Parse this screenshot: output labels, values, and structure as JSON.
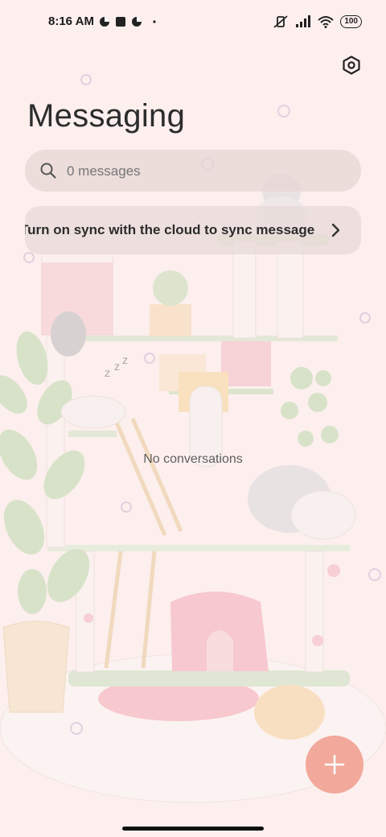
{
  "status_bar": {
    "time": "8:16 AM",
    "battery": "100",
    "icons": [
      "data-saver-icon",
      "app-square-icon",
      "data-saver-icon",
      "dot-icon",
      "mute-vibrate-icon",
      "signal-icon",
      "wifi-icon",
      "battery-icon"
    ]
  },
  "header": {
    "title": "Messaging",
    "settings_icon": "settings-icon"
  },
  "search": {
    "placeholder": "0 messages",
    "icon": "search-icon"
  },
  "sync_banner": {
    "text": "Turn on sync with the cloud to sync messages",
    "icon": "chevron-right-icon"
  },
  "empty_state": {
    "text": "No conversations"
  },
  "fab": {
    "icon": "plus-icon",
    "color": "#f2a89a"
  },
  "colors": {
    "background": "#fcefed",
    "accent": "#f2a89a"
  }
}
